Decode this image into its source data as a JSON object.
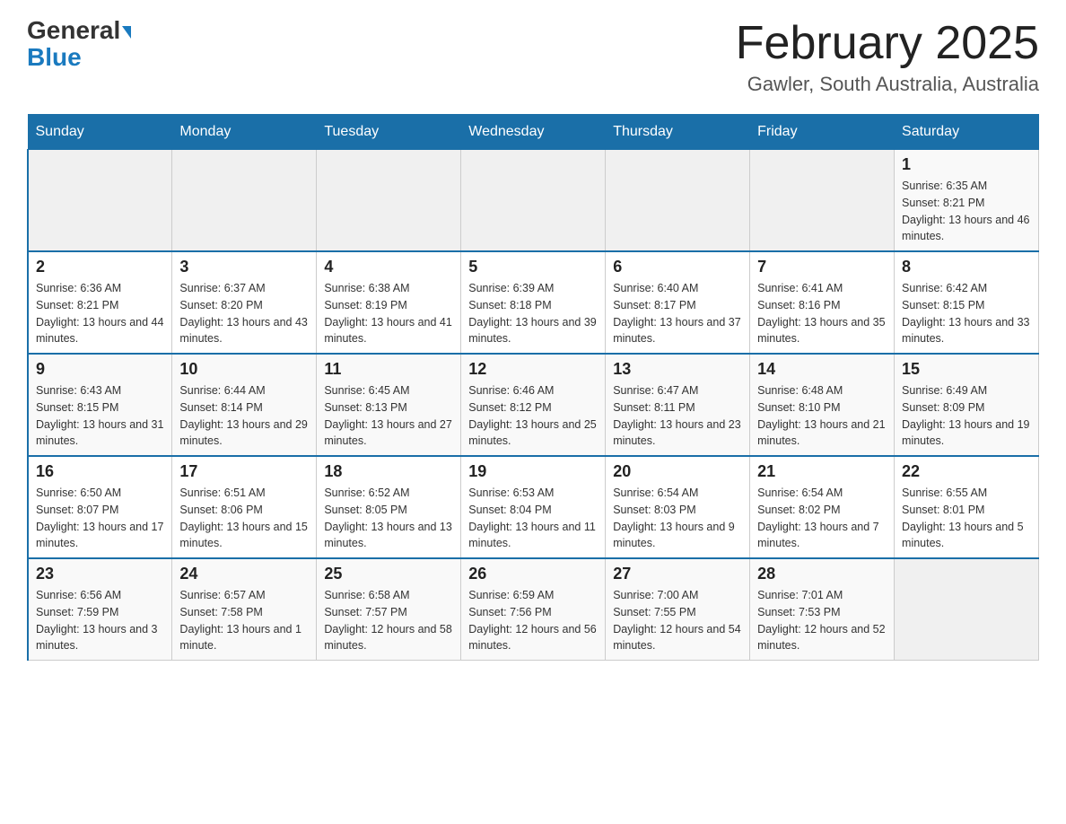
{
  "header": {
    "logo_general": "General",
    "logo_blue": "Blue",
    "title": "February 2025",
    "subtitle": "Gawler, South Australia, Australia"
  },
  "days_of_week": [
    "Sunday",
    "Monday",
    "Tuesday",
    "Wednesday",
    "Thursday",
    "Friday",
    "Saturday"
  ],
  "weeks": [
    {
      "days": [
        {
          "num": "",
          "info": ""
        },
        {
          "num": "",
          "info": ""
        },
        {
          "num": "",
          "info": ""
        },
        {
          "num": "",
          "info": ""
        },
        {
          "num": "",
          "info": ""
        },
        {
          "num": "",
          "info": ""
        },
        {
          "num": "1",
          "info": "Sunrise: 6:35 AM\nSunset: 8:21 PM\nDaylight: 13 hours and 46 minutes."
        }
      ]
    },
    {
      "days": [
        {
          "num": "2",
          "info": "Sunrise: 6:36 AM\nSunset: 8:21 PM\nDaylight: 13 hours and 44 minutes."
        },
        {
          "num": "3",
          "info": "Sunrise: 6:37 AM\nSunset: 8:20 PM\nDaylight: 13 hours and 43 minutes."
        },
        {
          "num": "4",
          "info": "Sunrise: 6:38 AM\nSunset: 8:19 PM\nDaylight: 13 hours and 41 minutes."
        },
        {
          "num": "5",
          "info": "Sunrise: 6:39 AM\nSunset: 8:18 PM\nDaylight: 13 hours and 39 minutes."
        },
        {
          "num": "6",
          "info": "Sunrise: 6:40 AM\nSunset: 8:17 PM\nDaylight: 13 hours and 37 minutes."
        },
        {
          "num": "7",
          "info": "Sunrise: 6:41 AM\nSunset: 8:16 PM\nDaylight: 13 hours and 35 minutes."
        },
        {
          "num": "8",
          "info": "Sunrise: 6:42 AM\nSunset: 8:15 PM\nDaylight: 13 hours and 33 minutes."
        }
      ]
    },
    {
      "days": [
        {
          "num": "9",
          "info": "Sunrise: 6:43 AM\nSunset: 8:15 PM\nDaylight: 13 hours and 31 minutes."
        },
        {
          "num": "10",
          "info": "Sunrise: 6:44 AM\nSunset: 8:14 PM\nDaylight: 13 hours and 29 minutes."
        },
        {
          "num": "11",
          "info": "Sunrise: 6:45 AM\nSunset: 8:13 PM\nDaylight: 13 hours and 27 minutes."
        },
        {
          "num": "12",
          "info": "Sunrise: 6:46 AM\nSunset: 8:12 PM\nDaylight: 13 hours and 25 minutes."
        },
        {
          "num": "13",
          "info": "Sunrise: 6:47 AM\nSunset: 8:11 PM\nDaylight: 13 hours and 23 minutes."
        },
        {
          "num": "14",
          "info": "Sunrise: 6:48 AM\nSunset: 8:10 PM\nDaylight: 13 hours and 21 minutes."
        },
        {
          "num": "15",
          "info": "Sunrise: 6:49 AM\nSunset: 8:09 PM\nDaylight: 13 hours and 19 minutes."
        }
      ]
    },
    {
      "days": [
        {
          "num": "16",
          "info": "Sunrise: 6:50 AM\nSunset: 8:07 PM\nDaylight: 13 hours and 17 minutes."
        },
        {
          "num": "17",
          "info": "Sunrise: 6:51 AM\nSunset: 8:06 PM\nDaylight: 13 hours and 15 minutes."
        },
        {
          "num": "18",
          "info": "Sunrise: 6:52 AM\nSunset: 8:05 PM\nDaylight: 13 hours and 13 minutes."
        },
        {
          "num": "19",
          "info": "Sunrise: 6:53 AM\nSunset: 8:04 PM\nDaylight: 13 hours and 11 minutes."
        },
        {
          "num": "20",
          "info": "Sunrise: 6:54 AM\nSunset: 8:03 PM\nDaylight: 13 hours and 9 minutes."
        },
        {
          "num": "21",
          "info": "Sunrise: 6:54 AM\nSunset: 8:02 PM\nDaylight: 13 hours and 7 minutes."
        },
        {
          "num": "22",
          "info": "Sunrise: 6:55 AM\nSunset: 8:01 PM\nDaylight: 13 hours and 5 minutes."
        }
      ]
    },
    {
      "days": [
        {
          "num": "23",
          "info": "Sunrise: 6:56 AM\nSunset: 7:59 PM\nDaylight: 13 hours and 3 minutes."
        },
        {
          "num": "24",
          "info": "Sunrise: 6:57 AM\nSunset: 7:58 PM\nDaylight: 13 hours and 1 minute."
        },
        {
          "num": "25",
          "info": "Sunrise: 6:58 AM\nSunset: 7:57 PM\nDaylight: 12 hours and 58 minutes."
        },
        {
          "num": "26",
          "info": "Sunrise: 6:59 AM\nSunset: 7:56 PM\nDaylight: 12 hours and 56 minutes."
        },
        {
          "num": "27",
          "info": "Sunrise: 7:00 AM\nSunset: 7:55 PM\nDaylight: 12 hours and 54 minutes."
        },
        {
          "num": "28",
          "info": "Sunrise: 7:01 AM\nSunset: 7:53 PM\nDaylight: 12 hours and 52 minutes."
        },
        {
          "num": "",
          "info": ""
        }
      ]
    }
  ]
}
